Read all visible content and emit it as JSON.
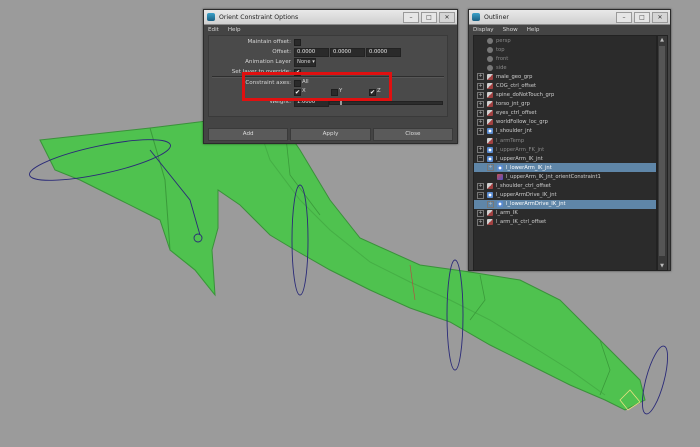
{
  "orient_dialog": {
    "title": "Orient Constraint Options",
    "menu": [
      "Edit",
      "Help"
    ],
    "maintain_offset_label": "Maintain offset:",
    "offset_label": "Offset:",
    "offset_values": [
      "0.0000",
      "0.0000",
      "0.0000"
    ],
    "animation_layer_label": "Animation Layer",
    "animation_layer_value": "None",
    "set_layer_label": "Set layer to override:",
    "set_layer_checked": "✔",
    "constraint_axes_label": "Constraint axes:",
    "all_label": "All",
    "x_label": "X",
    "y_label": "Y",
    "z_label": "Z",
    "x_checked": "✔",
    "z_checked": "✔",
    "weight_label": "Weight:",
    "weight_value": "1.0000",
    "weight_level": 0.1,
    "buttons": {
      "add": "Add",
      "apply": "Apply",
      "close": "Close"
    },
    "highlight_color": "#e01010"
  },
  "outliner": {
    "title": "Outliner",
    "menu": [
      "Display",
      "Show",
      "Help"
    ],
    "items": [
      {
        "label": "persp",
        "icon": "camera-icon",
        "expander": "",
        "dim": true
      },
      {
        "label": "top",
        "icon": "camera-icon",
        "expander": "",
        "dim": true
      },
      {
        "label": "front",
        "icon": "camera-icon",
        "expander": "",
        "dim": true
      },
      {
        "label": "side",
        "icon": "camera-icon",
        "expander": "",
        "dim": true
      },
      {
        "label": "male_geo_grp",
        "icon": "group-icon",
        "expander": "+"
      },
      {
        "label": "COG_ctrl_offset",
        "icon": "group-icon",
        "expander": "+"
      },
      {
        "label": "spine_doNotTouch_grp",
        "icon": "group-icon",
        "expander": "+"
      },
      {
        "label": "torso_jnt_grp",
        "icon": "group-icon",
        "expander": "+"
      },
      {
        "label": "eyes_ctrl_offset",
        "icon": "group-icon",
        "expander": "+"
      },
      {
        "label": "worldFollow_loc_grp",
        "icon": "group-icon",
        "expander": "+"
      },
      {
        "label": "l_shoulder_jnt",
        "icon": "joint-icon",
        "expander": "+"
      },
      {
        "label": "l_armTemp",
        "icon": "group-icon",
        "expander": "",
        "dim": true
      },
      {
        "label": "l_upperArm_FK_jnt",
        "icon": "joint-icon",
        "expander": "+",
        "dim": true
      },
      {
        "label": "l_upperArm_IK_jnt",
        "icon": "joint-icon",
        "expander": "−"
      },
      {
        "label": "l_lowerArm_IK_jnt",
        "icon": "joint-icon",
        "expander": "+",
        "indent": 1,
        "selected": true
      },
      {
        "label": "l_upperArm_IK_jnt_orientConstraint1",
        "icon": "constraint-icon",
        "expander": "",
        "indent": 1
      },
      {
        "label": "l_shoulder_ctrl_offset",
        "icon": "group-icon",
        "expander": "+"
      },
      {
        "label": "l_upperArmDrive_IK_jnt",
        "icon": "joint-icon",
        "expander": "−"
      },
      {
        "label": "l_lowerArmDrive_IK_jnt",
        "icon": "joint-icon",
        "expander": "+",
        "indent": 1,
        "selected": true
      },
      {
        "label": "l_arm_IK",
        "icon": "group-icon",
        "expander": "+"
      },
      {
        "label": "l_arm_IK_ctrl_offset",
        "icon": "group-icon",
        "expander": "+"
      }
    ]
  },
  "colors": {
    "viewport_bg": "#9a9a9a",
    "mesh_green": "#4fc24f",
    "selection_blue": "#5f86a8"
  }
}
